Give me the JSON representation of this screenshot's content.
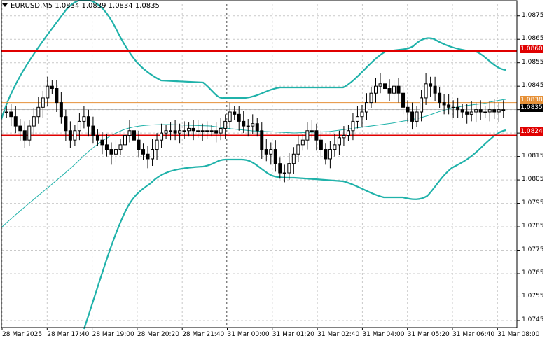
{
  "header": {
    "symbol": "EURUSD,M5",
    "ohlc": "1.0834 1.0839 1.0834 1.0835"
  },
  "colors": {
    "grid": "#c9c9c9",
    "band": "#20b2aa",
    "candle": "#000000",
    "resistance": "#e00000",
    "support": "#e00000",
    "orange": "#e69138",
    "last_price_bg": "#000000"
  },
  "levels": {
    "resistance": "1.0860",
    "support": "1.0824",
    "orange": "1.0838",
    "last": "1.0835"
  },
  "chart_data": {
    "type": "candlestick",
    "y_ticks": [
      "1.0875",
      "1.0865",
      "1.0855",
      "1.0845",
      "1.0835",
      "1.0825",
      "1.0815",
      "1.0805",
      "1.0795",
      "1.0785",
      "1.0775",
      "1.0765",
      "1.0755",
      "1.0745"
    ],
    "x_ticks": [
      "28 Mar 2025",
      "28 Mar 17:40",
      "28 Mar 19:00",
      "28 Mar 20:20",
      "28 Mar 21:40",
      "31 Mar 00:00",
      "31 Mar 01:20",
      "31 Mar 02:40",
      "31 Mar 04:00",
      "31 Mar 05:20",
      "31 Mar 06:40",
      "31 Mar 08:00"
    ],
    "ylim": [
      1.0742,
      1.088
    ],
    "closes": [
      1.0834,
      1.0832,
      1.0828,
      1.0826,
      1.0822,
      1.0828,
      1.0832,
      1.0836,
      1.084,
      1.0845,
      1.0844,
      1.0838,
      1.0832,
      1.0826,
      1.0822,
      1.0826,
      1.083,
      1.0832,
      1.0828,
      1.0824,
      1.0822,
      1.082,
      1.0818,
      1.0816,
      1.0818,
      1.082,
      1.0824,
      1.0826,
      1.0822,
      1.0818,
      1.0816,
      1.0814,
      1.0818,
      1.0822,
      1.0825,
      1.0826,
      1.0826,
      1.0825,
      1.0826,
      1.0826,
      1.0827,
      1.0826,
      1.0826,
      1.0826,
      1.0826,
      1.0826,
      1.0825,
      1.0827,
      1.083,
      1.0834,
      1.0833,
      1.083,
      1.0828,
      1.0828,
      1.0829,
      1.0826,
      1.0818,
      1.0816,
      1.0818,
      1.0812,
      1.0808,
      1.0808,
      1.0812,
      1.0816,
      1.082,
      1.0822,
      1.0826,
      1.0826,
      1.0822,
      1.0818,
      1.0814,
      1.0818,
      1.082,
      1.0823,
      1.0824,
      1.0826,
      1.083,
      1.0832,
      1.0834,
      1.0838,
      1.0842,
      1.0845,
      1.0846,
      1.0844,
      1.0842,
      1.0845,
      1.0842,
      1.0836,
      1.0834,
      1.083,
      1.0834,
      1.084,
      1.0846,
      1.0845,
      1.0842,
      1.0838,
      1.0837,
      1.0836,
      1.0836,
      1.0835,
      1.0834,
      1.0833,
      1.0834,
      1.0835,
      1.0834,
      1.0834,
      1.0835,
      1.0834,
      1.0835,
      1.0835
    ]
  }
}
